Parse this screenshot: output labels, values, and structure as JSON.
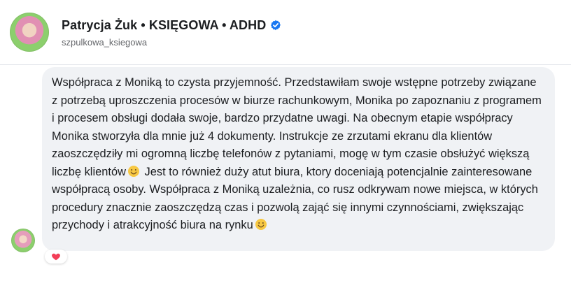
{
  "post": {
    "author": "Patrycja Żuk • KSIĘGOWA • ADHD",
    "username": "szpulkowa_ksiegowa",
    "verified_icon": "verified-badge-icon"
  },
  "comment": {
    "text_parts": [
      "Współpraca z Moniką to czysta przyjemność. Przedstawiłam swoje wstępne potrzeby związane z potrzebą uproszczenia procesów w biurze rachunkowym, Monika po zapoznaniu z programem i procesem obsługi dodała swoje, bardzo przydatne uwagi. Na obecnym etapie współpracy Monika stworzyła dla mnie już 4 dokumenty. Instrukcje ze zrzutami ekranu dla klientów zaoszczędziły mi ogromną liczbę telefonów z pytaniami, mogę w tym czasie obsłużyć większą liczbę klientów",
      " Jest to również duży atut biura, ktory doceniają potencjalnie zainteresowane współpracą osoby. Współpraca z Moniką uzależnia, co rusz odkrywam nowe miejsca, w których procedury znacznie zaoszczędzą czas i pozwolą zająć się innymi czynnościami, zwiększając przychody i atrakcyjność biura na rynku"
    ],
    "emoji_icons": [
      "smiling-face-emoji-icon",
      "smiling-face-emoji-icon"
    ],
    "reaction_icon": "heart-reaction-icon"
  },
  "colors": {
    "name_text": "#1c1e21",
    "username_text": "#65676b",
    "bubble_background": "#f0f2f5",
    "verified_blue": "#1877f2",
    "heart_red": "#f33e58"
  }
}
